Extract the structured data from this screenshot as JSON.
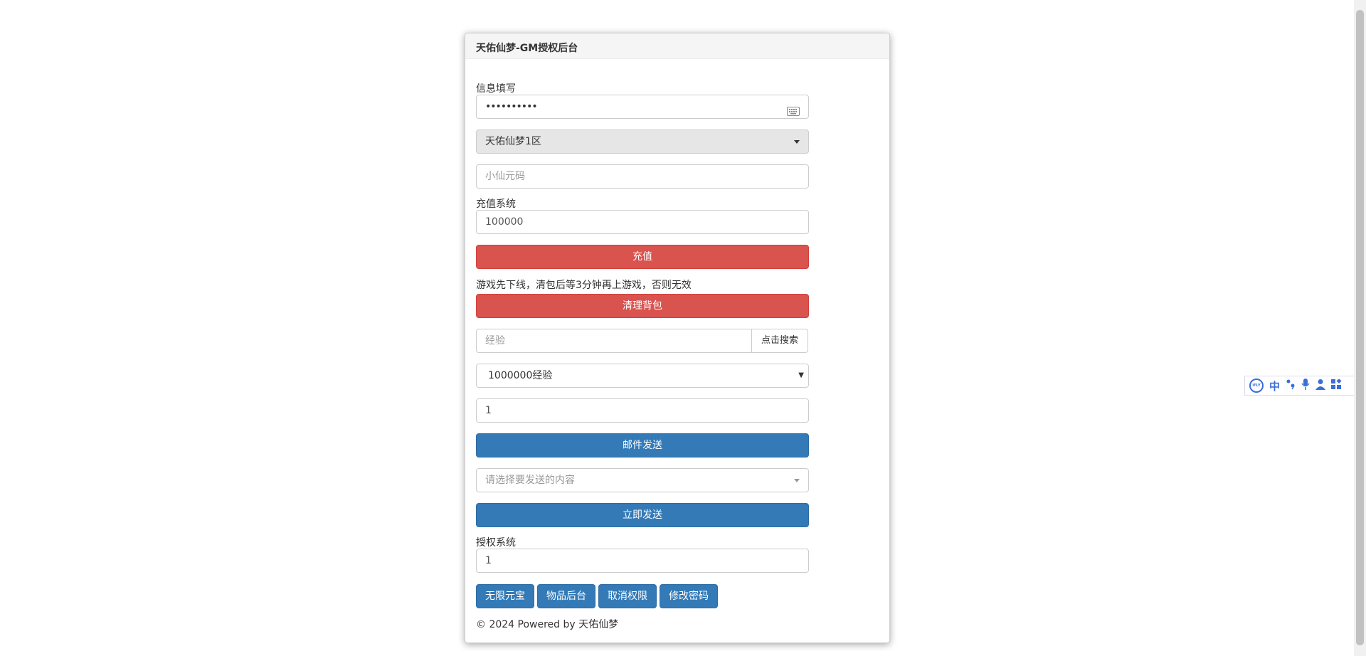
{
  "panel": {
    "title": "天佑仙梦-GM授权后台"
  },
  "info": {
    "label": "信息填写",
    "password_value": "••••••••••",
    "server_selected": "天佑仙梦1区",
    "code_placeholder": "小仙元码"
  },
  "recharge": {
    "label": "充值系统",
    "amount_value": "100000",
    "button": "充值"
  },
  "bag": {
    "notice": "游戏先下线，清包后等3分钟再上游戏，否则无效",
    "button": "清理背包"
  },
  "mail": {
    "search_value": "经验",
    "search_button": "点击搜索",
    "item_selected": "1000000经验",
    "quantity_value": "1",
    "button": "邮件发送"
  },
  "send": {
    "content_placeholder": "请选择要发送的内容",
    "button": "立即发送"
  },
  "auth": {
    "label": "授权系统",
    "value": "1",
    "buttons": [
      "无限元宝",
      "物品后台",
      "取消权限",
      "修改密码"
    ]
  },
  "footer": {
    "copyright": "© 2024 Powered by 天佑仙梦"
  },
  "ime_toolbar": {
    "logo": "iFLY",
    "lang": "中",
    "icons": [
      "punctuation-icon",
      "microphone-icon",
      "user-icon",
      "apps-icon"
    ]
  },
  "colors": {
    "danger": "#d9534f",
    "primary": "#337ab7",
    "ime": "#3b6fd8"
  }
}
